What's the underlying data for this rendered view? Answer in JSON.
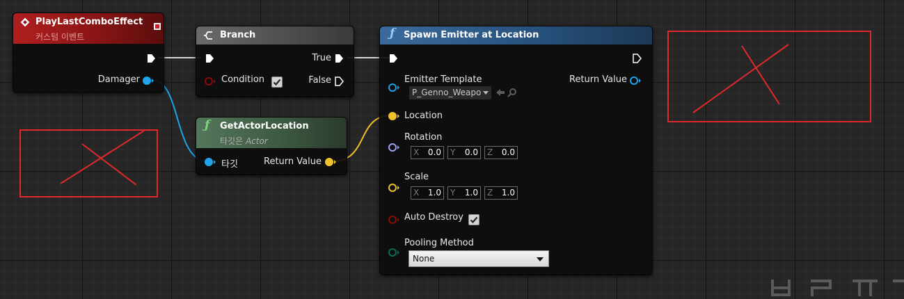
{
  "nodes": {
    "event": {
      "title": "PlayLastComboEffect",
      "subtitle": "커스텀 이벤트",
      "damager_label": "Damager"
    },
    "branch": {
      "title": "Branch",
      "condition_label": "Condition",
      "condition_checked": true,
      "true_label": "True",
      "false_label": "False"
    },
    "get_actor_location": {
      "title": "GetActorLocation",
      "subtitle_prefix": "타깃은",
      "subtitle_target": "Actor",
      "target_label": "타깃",
      "return_label": "Return Value"
    },
    "spawn_emitter": {
      "title": "Spawn Emitter at Location",
      "emitter_template_label": "Emitter Template",
      "emitter_template_value": "P_Genno_Weapor",
      "return_label": "Return Value",
      "location_label": "Location",
      "rotation_label": "Rotation",
      "rotation": {
        "x": "0.0",
        "y": "0.0",
        "z": "0.0"
      },
      "scale_label": "Scale",
      "scale": {
        "x": "1.0",
        "y": "1.0",
        "z": "1.0"
      },
      "auto_destroy_label": "Auto Destroy",
      "auto_destroy_checked": true,
      "pooling_label": "Pooling Method",
      "pooling_value": "None"
    }
  },
  "axis_labels": {
    "x": "X",
    "y": "Y",
    "z": "Z"
  },
  "colors": {
    "exec": "#ffffff",
    "object_pin": "#1fa3ea",
    "vector_pin": "#f0c12a",
    "rotator_pin": "#9aa6f2",
    "bool_pin": "#8b0b0b",
    "enum_pin": "#0b6d57",
    "event_header": "#9a1c1c",
    "branch_header": "#505050",
    "pure_header": "#3b5a3b",
    "function_header": "#264e78",
    "annotation": "#e0282d"
  },
  "icons": {
    "event": "event-diamond-icon",
    "branch": "branch-icon",
    "function": "function-icon"
  }
}
